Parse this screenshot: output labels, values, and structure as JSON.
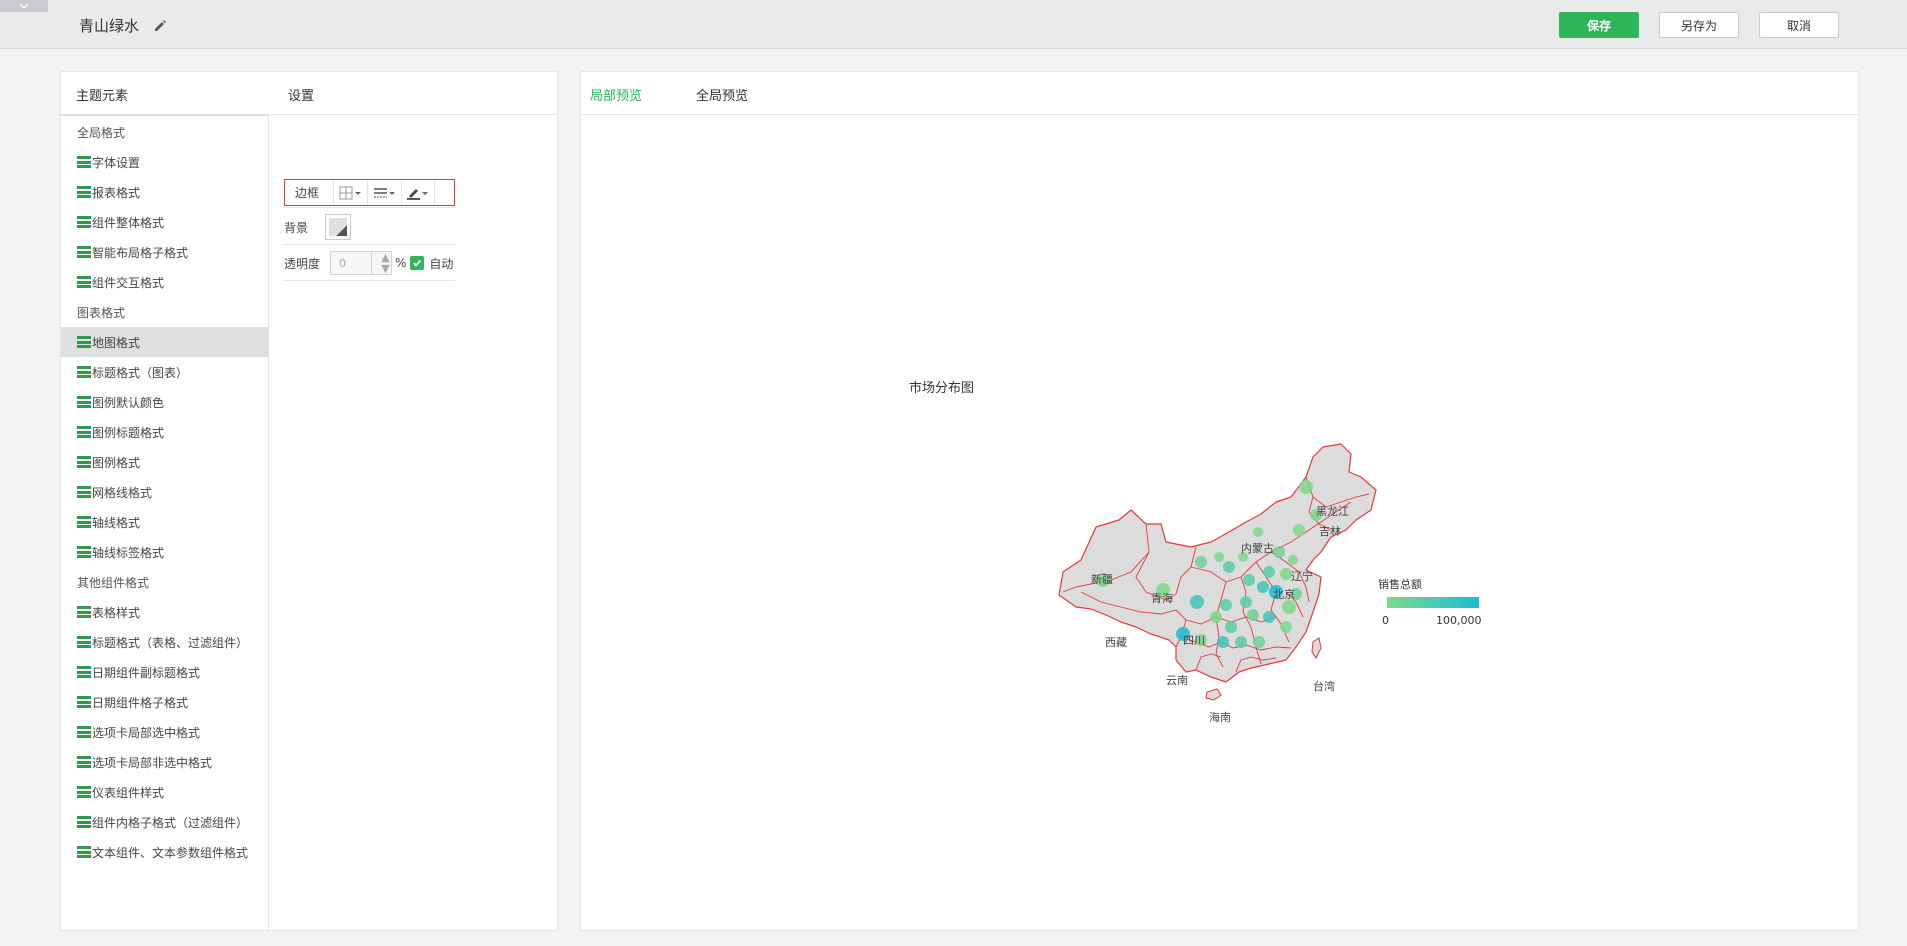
{
  "header": {
    "theme_name": "青山绿水",
    "save_label": "保存",
    "save_as_label": "另存为",
    "cancel_label": "取消"
  },
  "left_panel": {
    "tree_title": "主题元素",
    "settings_title": "设置",
    "tree": [
      {
        "type": "group",
        "label": "全局格式"
      },
      {
        "type": "leaf",
        "label": "字体设置"
      },
      {
        "type": "leaf",
        "label": "报表格式"
      },
      {
        "type": "leaf",
        "label": "组件整体格式"
      },
      {
        "type": "leaf",
        "label": "智能布局格子格式"
      },
      {
        "type": "leaf",
        "label": "组件交互格式"
      },
      {
        "type": "group",
        "label": "图表格式"
      },
      {
        "type": "leaf",
        "label": "地图格式",
        "selected": true
      },
      {
        "type": "leaf",
        "label": "标题格式（图表）"
      },
      {
        "type": "leaf",
        "label": "图例默认颜色"
      },
      {
        "type": "leaf",
        "label": "图例标题格式"
      },
      {
        "type": "leaf",
        "label": "图例格式"
      },
      {
        "type": "leaf",
        "label": "网格线格式"
      },
      {
        "type": "leaf",
        "label": "轴线格式"
      },
      {
        "type": "leaf",
        "label": "轴线标签格式"
      },
      {
        "type": "group",
        "label": "其他组件格式"
      },
      {
        "type": "leaf",
        "label": "表格样式"
      },
      {
        "type": "leaf",
        "label": "标题格式（表格、过滤组件）"
      },
      {
        "type": "leaf",
        "label": "日期组件副标题格式"
      },
      {
        "type": "leaf",
        "label": "日期组件格子格式"
      },
      {
        "type": "leaf",
        "label": "选项卡局部选中格式"
      },
      {
        "type": "leaf",
        "label": "选项卡局部非选中格式"
      },
      {
        "type": "leaf",
        "label": "仪表组件样式"
      },
      {
        "type": "leaf",
        "label": "组件内格子格式（过滤组件）"
      },
      {
        "type": "leaf",
        "label": "文本组件、文本参数组件格式"
      }
    ],
    "settings": {
      "border_label": "边框",
      "background_label": "背景",
      "opacity_label": "透明度",
      "opacity_value": "0",
      "percent_sign": "%",
      "auto_label": "自动",
      "auto_checked": true
    }
  },
  "preview": {
    "tabs": [
      {
        "label": "局部预览",
        "active": true
      },
      {
        "label": "全局预览",
        "active": false
      }
    ],
    "chart_title": "市场分布图",
    "legend_title": "销售总额",
    "legend_min": "0",
    "legend_max": "100,000",
    "province_labels": [
      "新疆",
      "西藏",
      "青海",
      "内蒙古",
      "黑龙江",
      "吉林",
      "辽宁",
      "四川",
      "云南",
      "台湾",
      "海南",
      "北京"
    ]
  },
  "colors": {
    "accent": "#2fb55a",
    "border_highlight": "#e4393c",
    "map_fill": "#dcdcdc",
    "map_border": "#e4393c",
    "legend_low": "#7ed88b",
    "legend_high": "#1abed0"
  }
}
